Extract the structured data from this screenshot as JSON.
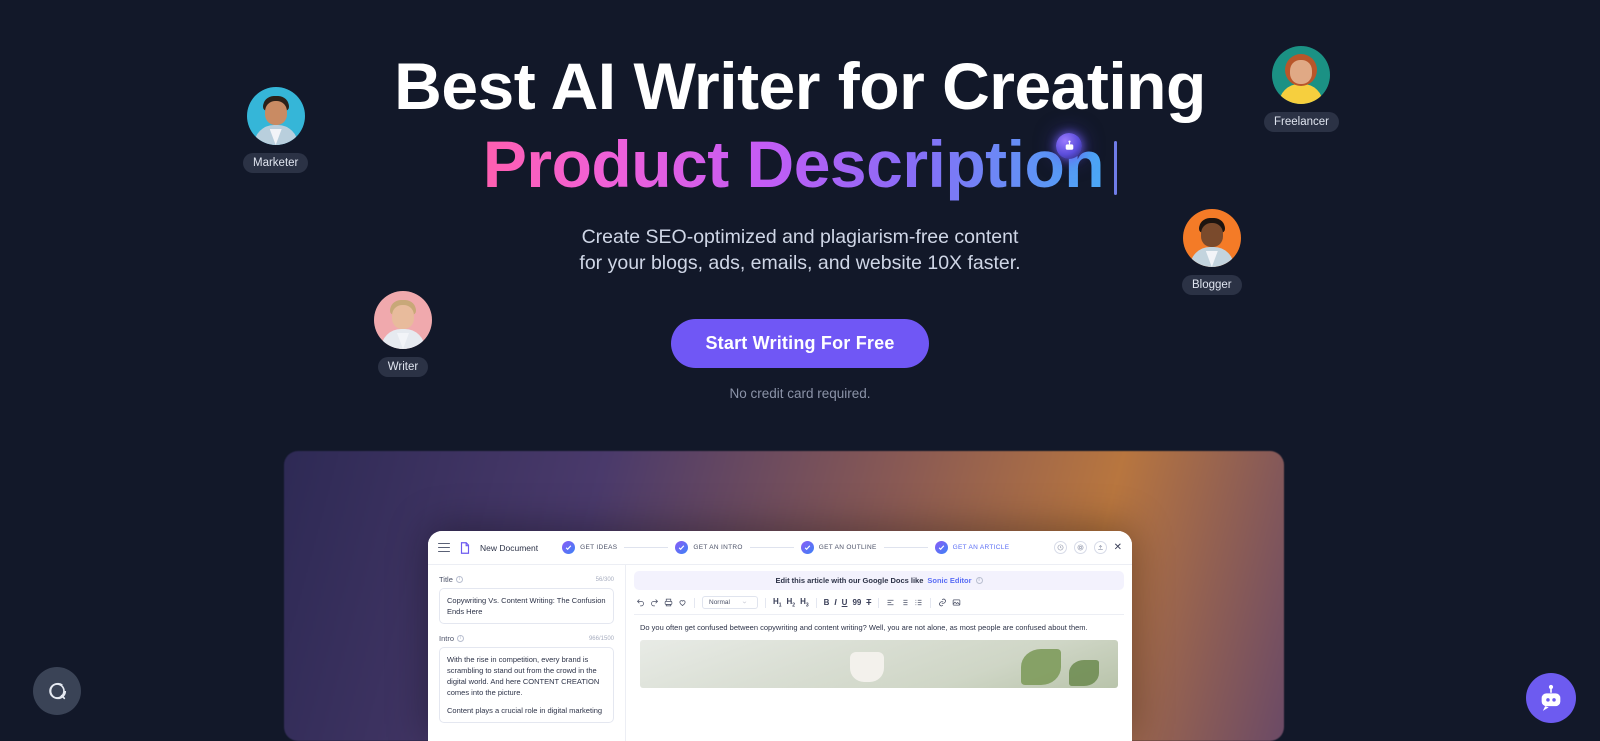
{
  "theme": {
    "background": "#121829",
    "accent": "#7057f5",
    "headline_gradient_from": "#ff5fb0",
    "headline_gradient_mid": "#c45cf5",
    "headline_gradient_to": "#4aa8f5"
  },
  "hero": {
    "headline_line1": "Best AI Writer for Creating",
    "headline_line2": "Product Description",
    "subtitle_line1": "Create SEO-optimized and plagiarism-free content",
    "subtitle_line2": "for your blogs, ads, emails, and website 10X faster.",
    "cta_label": "Start Writing For Free",
    "cta_note": "No credit card required."
  },
  "personas": [
    {
      "label": "Marketer",
      "avatar_bg": "#35b6d8",
      "hair": "#2b2119",
      "skin": "#c98b63",
      "shirt": "#b9cfdd"
    },
    {
      "label": "Freelancer",
      "avatar_bg": "#1b9184",
      "hair": "#b8562a",
      "skin": "#e0a985",
      "shirt": "#f6cf3e"
    },
    {
      "label": "Blogger",
      "avatar_bg": "#f47b27",
      "hair": "#1c1410",
      "skin": "#7a4a2c",
      "shirt": "#c3d4de"
    },
    {
      "label": "Writer",
      "avatar_bg": "#f0a9ad",
      "hair": "#c8a878",
      "skin": "#e8bb9c",
      "shirt": "#e6eaf0"
    }
  ],
  "app": {
    "doc_name": "New Document",
    "steps": [
      {
        "label": "GET IDEAS",
        "active": false
      },
      {
        "label": "GET AN INTRO",
        "active": false
      },
      {
        "label": "GET AN OUTLINE",
        "active": false
      },
      {
        "label": "GET AN ARTICLE",
        "active": true
      }
    ],
    "left_panel": {
      "title_label": "Title",
      "title_count": "56/300",
      "title_value": "Copywriting Vs. Content Writing: The Confusion Ends Here",
      "intro_label": "Intro",
      "intro_count": "966/1500",
      "intro_para1": "With the rise in competition, every brand is scrambling to stand out from the crowd in the digital world. And here CONTENT CREATION comes into the picture.",
      "intro_para2": "Content plays a crucial role in digital marketing"
    },
    "editor": {
      "banner_text": "Edit this article with our Google Docs like",
      "banner_link": "Sonic Editor",
      "style_select": "Normal",
      "heading_1": "H",
      "heading_1_sub": "1",
      "heading_2": "H",
      "heading_2_sub": "2",
      "heading_3": "H",
      "heading_3_sub": "3",
      "bold": "B",
      "italic": "I",
      "underline": "U",
      "quote": "99",
      "strike": "T",
      "body_text": "Do you often get confused between copywriting and content writing? Well, you are not alone, as most people are confused about them."
    }
  },
  "widgets": {
    "help_label": "help-chat",
    "bot_label": "assistant-bot"
  }
}
